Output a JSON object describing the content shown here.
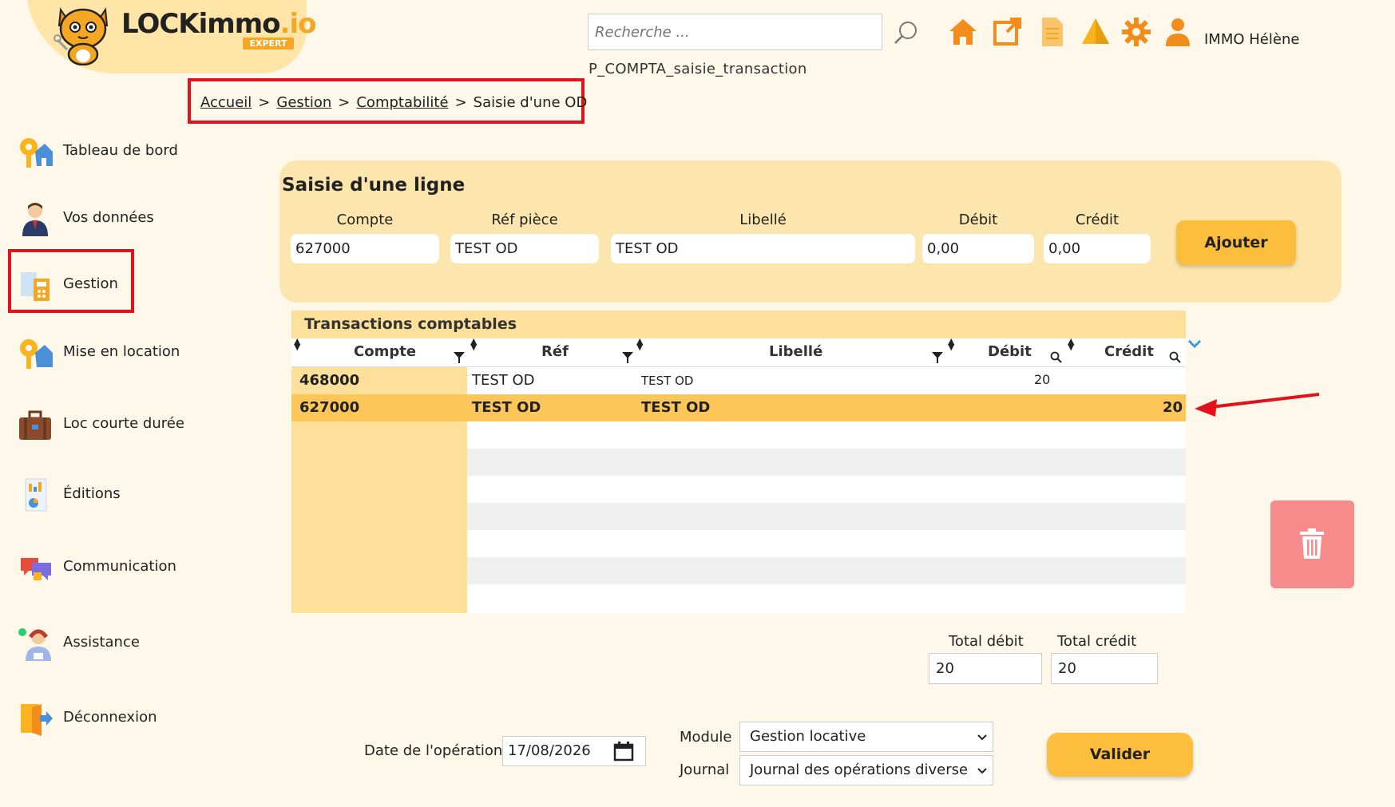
{
  "logo": {
    "brand": "LOCKimmo",
    "suffix": ".io",
    "badge": "EXPERT"
  },
  "header": {
    "search_placeholder": "Recherche ...",
    "page_code": "P_COMPTA_saisie_transaction",
    "user_name": "IMMO Hélène",
    "icons": [
      "home-icon",
      "external-link-icon",
      "document-icon",
      "alert-icon",
      "settings-icon",
      "user-icon"
    ]
  },
  "breadcrumb": {
    "items": [
      "Accueil",
      "Gestion",
      "Comptabilité"
    ],
    "current": "Saisie d'une OD",
    "separator": ">"
  },
  "sidebar": {
    "items": [
      {
        "label": "Tableau de bord",
        "icon": "dashboard-icon"
      },
      {
        "label": "Vos données",
        "icon": "person-icon"
      },
      {
        "label": "Gestion",
        "icon": "management-icon"
      },
      {
        "label": "Mise en location",
        "icon": "keys-icon"
      },
      {
        "label": "Loc courte durée",
        "icon": "suitcase-icon"
      },
      {
        "label": "Éditions",
        "icon": "report-icon"
      },
      {
        "label": "Communication",
        "icon": "chat-icon"
      },
      {
        "label": "Assistance",
        "icon": "support-icon"
      },
      {
        "label": "Déconnexion",
        "icon": "logout-icon"
      }
    ],
    "highlighted": "Gestion"
  },
  "saisie": {
    "title": "Saisie d'une ligne",
    "labels": {
      "compte": "Compte",
      "ref": "Réf pièce",
      "libelle": "Libellé",
      "debit": "Débit",
      "credit": "Crédit"
    },
    "values": {
      "compte": "627000",
      "ref": "TEST OD",
      "libelle": "TEST OD",
      "debit": "0,00",
      "credit": "0,00"
    },
    "add_button": "Ajouter"
  },
  "table": {
    "caption": "Transactions comptables",
    "columns": [
      "Compte",
      "Réf",
      "Libellé",
      "Débit",
      "Crédit"
    ],
    "rows": [
      {
        "compte": "468000",
        "ref": "TEST OD",
        "libelle": "TEST OD",
        "debit": "20",
        "credit": ""
      },
      {
        "compte": "627000",
        "ref": "TEST OD",
        "libelle": "TEST OD",
        "debit": "",
        "credit": "20"
      }
    ],
    "selected_row": 1,
    "empty_rows": 7
  },
  "totals": {
    "debit_label": "Total débit",
    "credit_label": "Total crédit",
    "debit": "20",
    "credit": "20"
  },
  "operation": {
    "date_label": "Date de l'opération",
    "date": "17/08/2026",
    "module_label": "Module",
    "module": "Gestion locative",
    "journal_label": "Journal",
    "journal": "Journal des opérations diverse",
    "submit": "Valider"
  },
  "colors": {
    "accent": "#fdbd3d",
    "panel": "#fde6ad",
    "highlight": "#e0131d",
    "delete": "#f78a8a",
    "selected_row": "#fcc659"
  }
}
